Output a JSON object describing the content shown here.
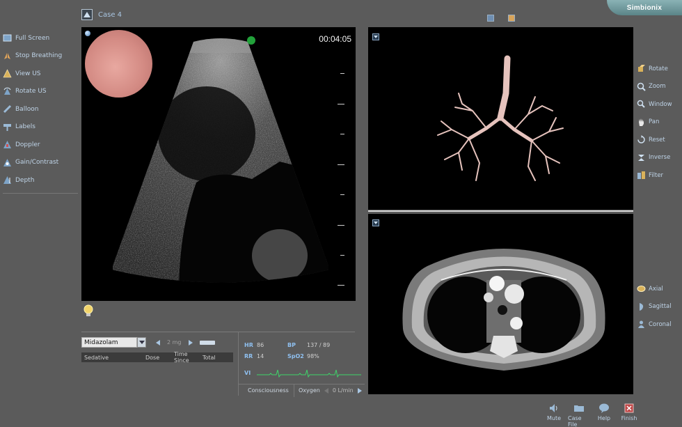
{
  "header": {
    "case_label": "Case 4",
    "logo_text": "Simbionix"
  },
  "left_menu": {
    "items": [
      {
        "label": "Full Screen",
        "icon": "fullscreen-icon"
      },
      {
        "label": "Stop Breathing",
        "icon": "lungs-icon"
      },
      {
        "label": "View US",
        "icon": "view-us-icon"
      },
      {
        "label": "Rotate US",
        "icon": "rotate-us-icon"
      },
      {
        "label": "Balloon",
        "icon": "balloon-icon"
      },
      {
        "label": "Labels",
        "icon": "labels-icon"
      },
      {
        "label": "Doppler",
        "icon": "doppler-icon"
      },
      {
        "label": "Gain/Contrast",
        "icon": "gain-icon"
      },
      {
        "label": "Depth",
        "icon": "depth-icon"
      }
    ]
  },
  "ultrasound": {
    "timer": "00:04:05"
  },
  "drug": {
    "selected": "Midazolam",
    "dose": "2 mg",
    "columns": [
      "Sedative",
      "Dose",
      "Time Since",
      "Total"
    ]
  },
  "vitals": {
    "hr_label": "HR",
    "hr_value": "86",
    "bp_label": "BP",
    "bp_value": "137 / 89",
    "rr_label": "RR",
    "rr_value": "14",
    "spo2_label": "SpO2",
    "spo2_value": "98%",
    "vi_label": "VI"
  },
  "status_strip": {
    "consciousness": "Consciousness",
    "oxygen_label": "Oxygen",
    "oxygen_value": "0 L/min"
  },
  "right_menu": {
    "tools": [
      {
        "label": "Rotate",
        "icon": "rotate-icon"
      },
      {
        "label": "Zoom",
        "icon": "zoom-icon"
      },
      {
        "label": "Window",
        "icon": "window-icon"
      },
      {
        "label": "Pan",
        "icon": "pan-icon"
      },
      {
        "label": "Reset",
        "icon": "reset-icon"
      },
      {
        "label": "Inverse",
        "icon": "inverse-icon"
      },
      {
        "label": "Filter",
        "icon": "filter-icon"
      }
    ],
    "views": [
      {
        "label": "Axial",
        "icon": "axial-icon"
      },
      {
        "label": "Sagittal",
        "icon": "sagittal-icon"
      },
      {
        "label": "Coronal",
        "icon": "coronal-icon"
      }
    ]
  },
  "bottom_buttons": [
    {
      "label": "Mute",
      "icon": "speaker-icon"
    },
    {
      "label": "Case File",
      "icon": "folder-icon"
    },
    {
      "label": "Help",
      "icon": "help-icon"
    },
    {
      "label": "Finish",
      "icon": "finish-icon"
    }
  ],
  "colors": {
    "background": "#5b5b5b",
    "accent_text": "#a9c6e2",
    "vital_key": "#8fc0f0",
    "ecg_line": "#3fd46a",
    "airway": "#e6c3bd"
  }
}
